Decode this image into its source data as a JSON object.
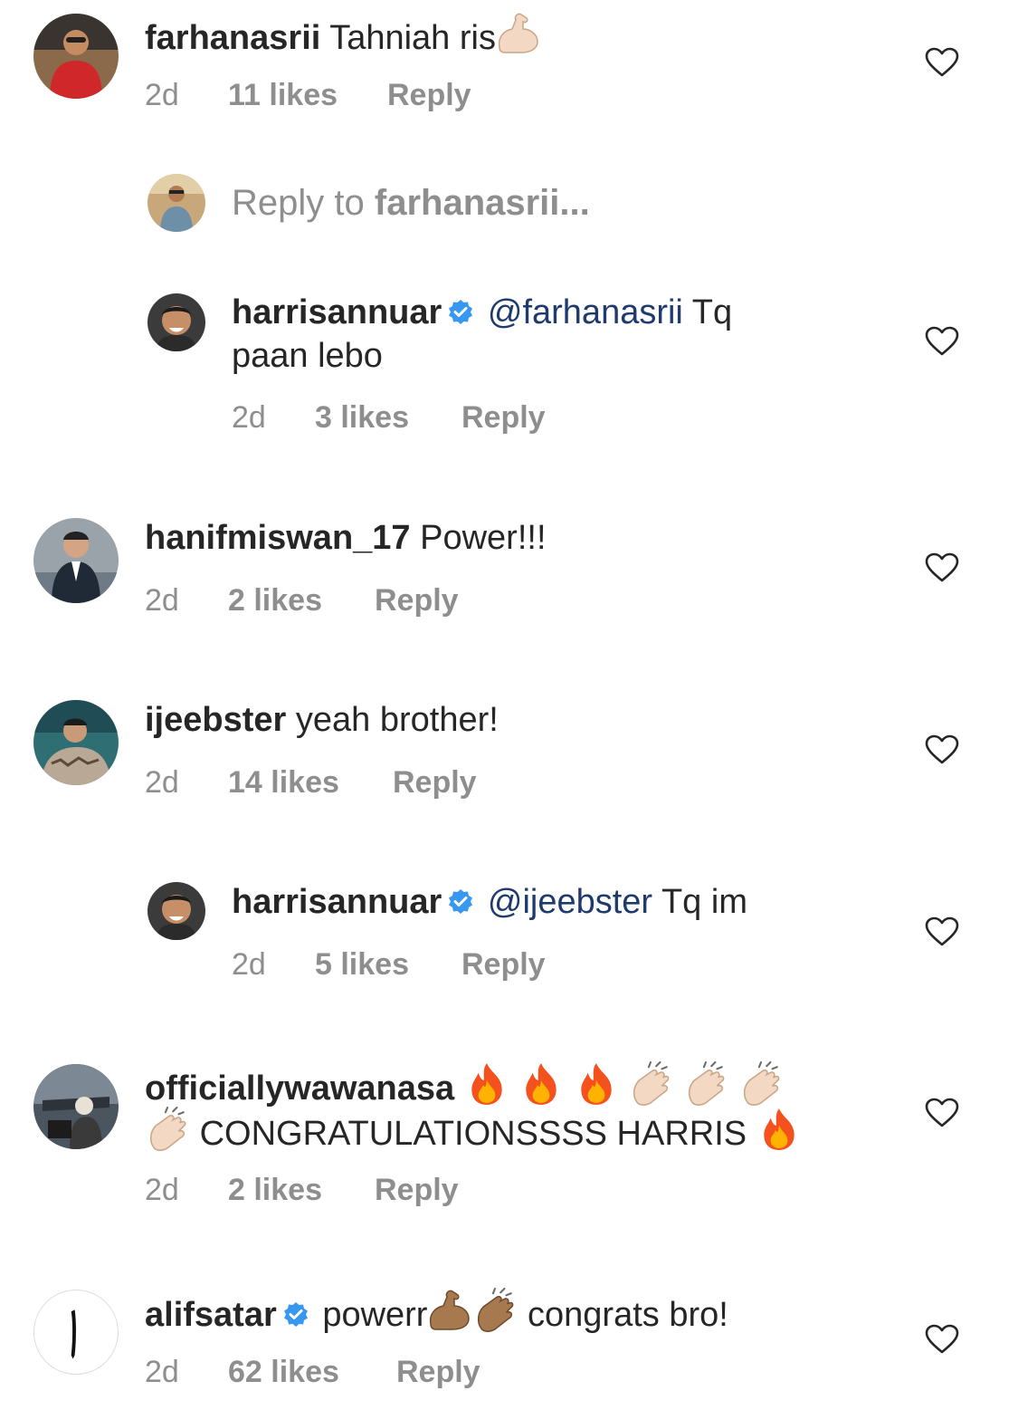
{
  "comments": [
    {
      "username": "farhanasrii",
      "text": "Tahniah ris",
      "emoji": [
        "muscle-light"
      ],
      "time": "2d",
      "likes": "11 likes",
      "reply": "Reply",
      "avatar": "avatar-farhanasrii"
    },
    {
      "username": "harrisannuar",
      "verified": true,
      "mention": "@farhanasrii",
      "text_line1": "Tq",
      "text_line2": "paan lebo",
      "time": "2d",
      "likes": "3 likes",
      "reply": "Reply",
      "avatar": "avatar-harrisannuar"
    },
    {
      "username": "hanifmiswan_17",
      "text": "Power!!!",
      "time": "2d",
      "likes": "2 likes",
      "reply": "Reply",
      "avatar": "avatar-hanifmiswan"
    },
    {
      "username": "ijeebster",
      "text": "yeah brother!",
      "time": "2d",
      "likes": "14 likes",
      "reply": "Reply",
      "avatar": "avatar-ijeebster"
    },
    {
      "username": "harrisannuar",
      "verified": true,
      "mention": "@ijeebster",
      "text": "Tq im",
      "time": "2d",
      "likes": "5 likes",
      "reply": "Reply",
      "avatar": "avatar-harrisannuar"
    },
    {
      "username": "officiallywawanasa",
      "emoji_line1": [
        "fire",
        "fire",
        "fire",
        "clap",
        "clap",
        "clap"
      ],
      "text_line2": "CONGRATULATIONSSSS HARRIS",
      "emoji_line2_lead": [
        "clap"
      ],
      "emoji_line2_trail": [
        "fire"
      ],
      "time": "2d",
      "likes": "2 likes",
      "reply": "Reply",
      "avatar": "avatar-officiallywawanasa"
    },
    {
      "username": "alifsatar",
      "verified": true,
      "text_part1": "powerr",
      "emoji": [
        "muscle-medium",
        "clap-medium"
      ],
      "text_part2": "congrats bro!",
      "time": "2d",
      "likes": "62 likes",
      "reply": "Reply",
      "avatar": "avatar-alifsatar"
    }
  ],
  "reply_prompt": {
    "prefix": "Reply to",
    "username": "farhanasrii..."
  },
  "colors": {
    "text": "#262626",
    "meta": "#8e8e8e",
    "mention": "#1f3b6e",
    "verified": "#3897f0"
  },
  "icons": [
    "heart-outline-icon",
    "verified-badge-icon",
    "fire-emoji",
    "clap-emoji",
    "muscle-emoji"
  ]
}
